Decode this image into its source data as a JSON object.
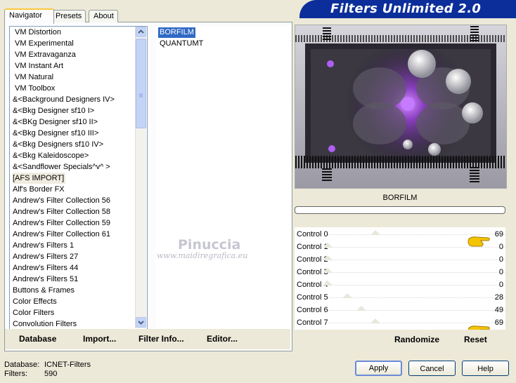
{
  "banner": {
    "title": "Filters Unlimited 2.0"
  },
  "tabs": [
    {
      "label": "Navigator",
      "active": true
    },
    {
      "label": "Presets",
      "active": false
    },
    {
      "label": "About",
      "active": false
    }
  ],
  "categories": [
    "VM Distortion",
    "VM Experimental",
    "VM Extravaganza",
    "VM Instant Art",
    "VM Natural",
    "VM Toolbox",
    "&<Background Designers IV>",
    "&<Bkg Designer sf10 I>",
    "&<BKg Designer sf10 II>",
    "&<Bkg Designer sf10 III>",
    "&<Bkg Designers sf10 IV>",
    "&<Bkg Kaleidoscope>",
    "&<Sandflower Specials^v^ >",
    "[AFS IMPORT]",
    "Alf's Border FX",
    "Andrew's Filter Collection 56",
    "Andrew's Filter Collection 58",
    "Andrew's Filter Collection 59",
    "Andrew's Filter Collection 61",
    "Andrew's Filters 1",
    "Andrew's Filters 27",
    "Andrew's Filters 44",
    "Andrew's Filters 51",
    "Buttons & Frames",
    "Color Effects",
    "Color Filters",
    "Convolution Filters"
  ],
  "filters": [
    "BORFILM",
    "QUANTUMT"
  ],
  "watermark": {
    "name": "Pinuccia",
    "url": "www.maidiregrafica.eu"
  },
  "panel_buttons": {
    "database": "Database",
    "import": "Import...",
    "filter_info": "Filter Info...",
    "editor": "Editor..."
  },
  "preview": {
    "filter_name": "BORFILM",
    "progress": 0
  },
  "controls": [
    {
      "label": "Control 0",
      "value": "69",
      "fraction": 0.27
    },
    {
      "label": "Control 1",
      "value": "0",
      "fraction": 0
    },
    {
      "label": "Control 2",
      "value": "0",
      "fraction": 0
    },
    {
      "label": "Control 3",
      "value": "0",
      "fraction": 0
    },
    {
      "label": "Control 4",
      "value": "0",
      "fraction": 0
    },
    {
      "label": "Control 5",
      "value": "28",
      "fraction": 0.11
    },
    {
      "label": "Control 6",
      "value": "49",
      "fraction": 0.19
    },
    {
      "label": "Control 7",
      "value": "69",
      "fraction": 0.27
    }
  ],
  "preset_buttons": {
    "randomize": "Randomize",
    "reset": "Reset"
  },
  "footer": {
    "database_label": "Database:",
    "database_value": "ICNET-Filters",
    "filters_label": "Filters:",
    "filters_value": "590"
  },
  "dialog_buttons": {
    "apply": "Apply",
    "cancel": "Cancel",
    "help": "Help"
  },
  "colors": {
    "banner": "#0b2e9a",
    "selection": "#316ac5",
    "pointer": "#f4c400"
  }
}
